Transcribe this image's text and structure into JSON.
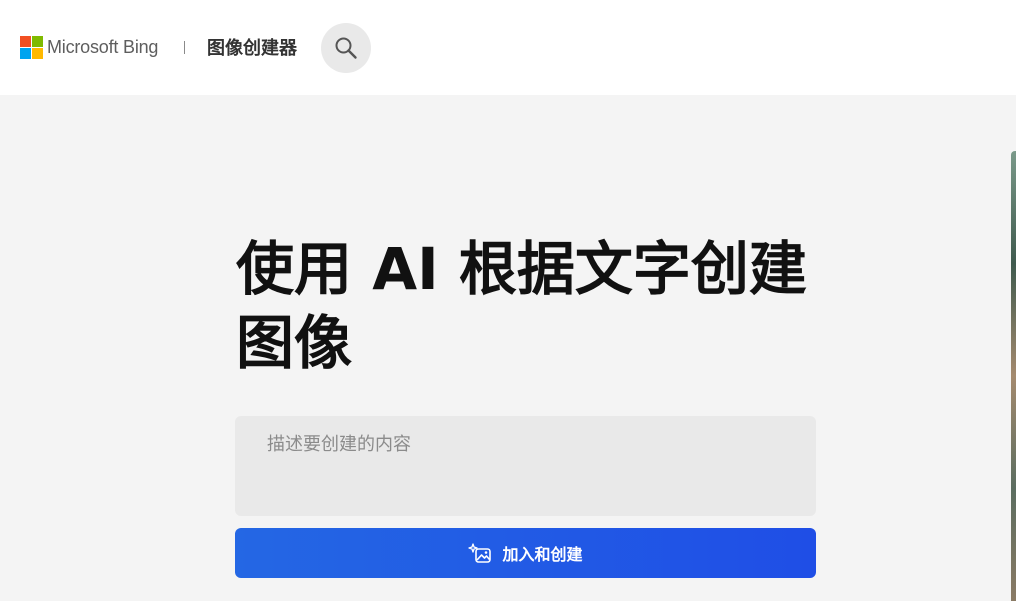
{
  "header": {
    "brand": "Microsoft Bing",
    "product": "图像创建器",
    "search_icon": "search-icon"
  },
  "hero": {
    "title": "使用 AI 根据文字创建图像"
  },
  "prompt": {
    "placeholder": "描述要创建的内容",
    "value": ""
  },
  "actions": {
    "create_label": "加入和创建",
    "create_icon": "image-sparkle-icon"
  },
  "colors": {
    "ms_red": "#f25022",
    "ms_green": "#7fba00",
    "ms_blue": "#00a4ef",
    "ms_yellow": "#ffb900",
    "button_blue": "#2467e4"
  }
}
